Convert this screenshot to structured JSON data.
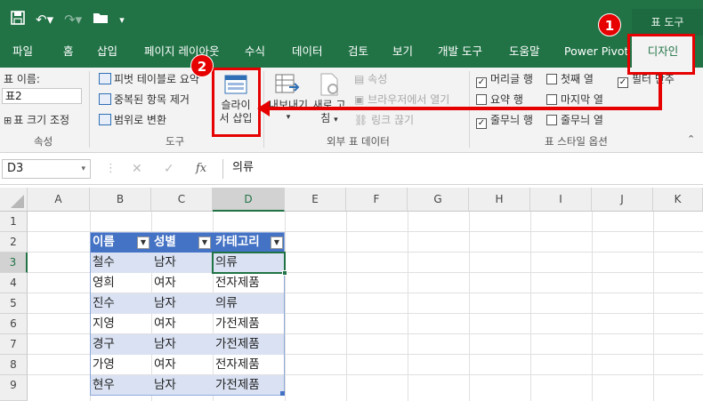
{
  "context_tab_title": "표 도구",
  "tabs": [
    "파일",
    "홈",
    "삽입",
    "페이지 레이아웃",
    "수식",
    "데이터",
    "검토",
    "보기",
    "개발 도구",
    "도움말",
    "Power Pivot",
    "디자인"
  ],
  "ribbon": {
    "properties": {
      "name_label": "표 이름:",
      "name_value": "표2",
      "resize_label": "표 크기 조정",
      "group_label": "속성"
    },
    "tools": {
      "pivot_label": "피벗 테이블로 요약",
      "dedupe_label": "중복된 항목 제거",
      "convert_label": "범위로 변환",
      "slicer_label_1": "슬라이",
      "slicer_label_2": "서 삽입",
      "group_label": "도구"
    },
    "external": {
      "export_label_1": "내보내기",
      "refresh_label_1": "새로 고",
      "refresh_label_2": "침",
      "properties_label": "속성",
      "open_browser_label": "브라우저에서 열기",
      "unlink_label": "링크 끊기",
      "group_label": "외부 표 데이터"
    },
    "style_options": {
      "header_row": "머리글 행",
      "first_column": "첫째 열",
      "filter_button": "필터 단추",
      "total_row": "요약 행",
      "last_column": "마지막 열",
      "banded_rows": "줄무늬 행",
      "banded_columns": "줄무늬 열",
      "group_label": "표 스타일 옵션"
    }
  },
  "annotations": {
    "badge_1": "1",
    "badge_2": "2"
  },
  "formula_bar": {
    "name_box": "D3",
    "fx": "fx",
    "cancel": "✕",
    "enter": "✓",
    "content": "의류"
  },
  "grid": {
    "columns": [
      "A",
      "B",
      "C",
      "D",
      "E",
      "F",
      "G",
      "H",
      "I",
      "J",
      "K"
    ],
    "rows": [
      "1",
      "2",
      "3",
      "4",
      "5",
      "6",
      "7",
      "8",
      "9"
    ],
    "table_headers": [
      "이름",
      "성별",
      "카테고리"
    ],
    "table_rows": [
      [
        "철수",
        "남자",
        "의류"
      ],
      [
        "영희",
        "여자",
        "전자제품"
      ],
      [
        "진수",
        "남자",
        "의류"
      ],
      [
        "지영",
        "여자",
        "가전제품"
      ],
      [
        "경구",
        "남자",
        "가전제품"
      ],
      [
        "가영",
        "여자",
        "전자제품"
      ],
      [
        "현우",
        "남자",
        "가전제품"
      ]
    ]
  },
  "colors": {
    "excel_green": "#217346",
    "table_header": "#4472c4",
    "table_band": "#d9e1f2",
    "highlight_red": "#e60000"
  }
}
